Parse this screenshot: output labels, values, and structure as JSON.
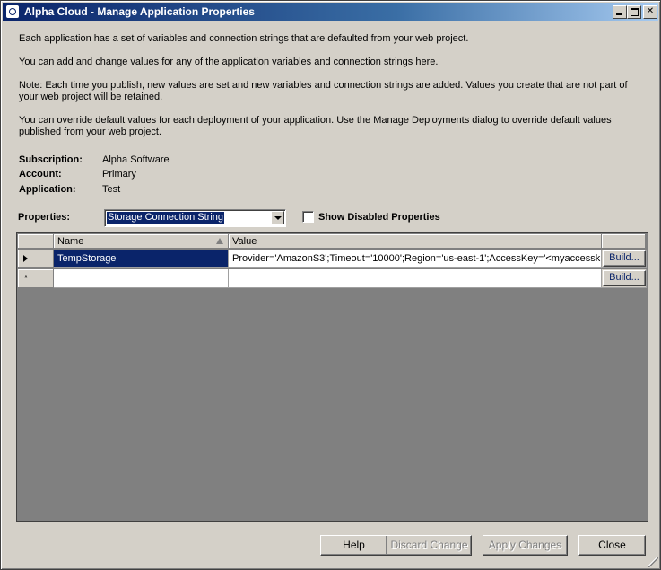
{
  "window": {
    "title": "Alpha Cloud - Manage Application Properties",
    "minimize_glyph": "",
    "maximize_glyph": "",
    "close_glyph": "✕"
  },
  "intro": {
    "p1": "Each application has a set of variables and connection strings that are defaulted from your web project.",
    "p2": "You can add and change values for any of the application variables and connection strings here.",
    "p3": "Note: Each time you publish, new values are set and new variables and connection strings are added. Values you create that are not part of your web project will be retained.",
    "p4": "You can override default values for each deployment of your application.  Use the Manage Deployments dialog to override default values published from your web project."
  },
  "info": {
    "subscription_label": "Subscription:",
    "subscription_value": "Alpha Software",
    "account_label": "Account:",
    "account_value": "Primary",
    "application_label": "Application:",
    "application_value": "Test"
  },
  "properties": {
    "label": "Properties:",
    "selected": "Storage Connection String",
    "show_disabled_label": "Show Disabled Properties",
    "show_disabled_checked": false
  },
  "grid": {
    "columns": [
      "Name",
      "Value"
    ],
    "rows": [
      {
        "name": "TempStorage",
        "value": "Provider='AmazonS3';Timeout='10000';Region='us-east-1';AccessKey='<myaccessk...",
        "button": "Build..."
      },
      {
        "marker": "*",
        "name": "",
        "value": "",
        "button": "Build..."
      }
    ]
  },
  "buttons": {
    "help": "Help",
    "discard": "Discard Change",
    "apply": "Apply Changes",
    "close": "Close"
  },
  "colors": {
    "title_bar": "#0a246a",
    "selection": "#0a246a",
    "dialog_bg": "#d4d0c8",
    "grid_bg": "#808080"
  }
}
